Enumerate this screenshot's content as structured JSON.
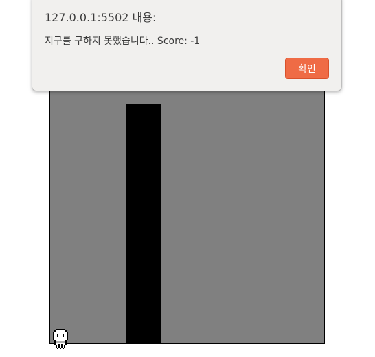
{
  "alert": {
    "title": "127.0.0.1:5502 내용:",
    "message": "지구를 구하지 못했습니다.. Score: -1",
    "ok_label": "확인"
  },
  "game": {
    "player_icon": "pixel-ghost-icon"
  },
  "colors": {
    "canvas_background": "#808080",
    "pillar": "#000000",
    "ok_button": "#ef6b45",
    "dialog_background": "#f1f0ee"
  }
}
